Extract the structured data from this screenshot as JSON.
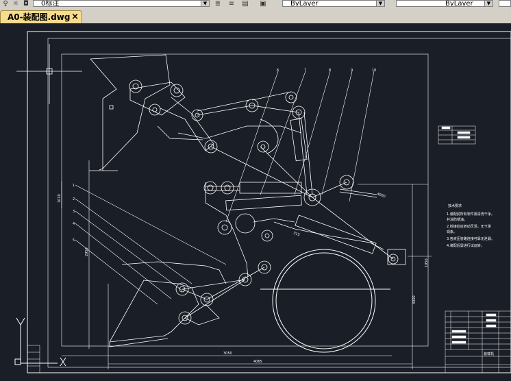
{
  "toolbar": {
    "dimstyle_value": "0标注",
    "layer_value": "ByLayer",
    "linetype_value": "ByLayer",
    "icons": [
      "bulb-icon",
      "sun-icon",
      "style-icon",
      "text-style-icon",
      "table-icon",
      "layer-icon"
    ]
  },
  "document_tab": {
    "label": "A0-装配图.dwg",
    "close_glyph": "×"
  },
  "drawing": {
    "background": "#1a1e27",
    "line_color": "#ffffff",
    "dim_labels": [
      "3050",
      "4065",
      "4000",
      "2950",
      "1010",
      "4900",
      "1050",
      "315"
    ],
    "part_numbers": [
      "6",
      "7",
      "8",
      "9",
      "10",
      "1",
      "2",
      "3",
      "4",
      "5"
    ],
    "tech_requirements": {
      "heading": "技术要求",
      "lines": [
        "1.装配前所有零件需清洗干净，",
        "  并涂防锈油。",
        "2.铰接处应转动灵活，无卡滞",
        "  现象。",
        "3.各液压管路连接可靠无泄漏。",
        "4.装配后需进行试运转。"
      ]
    },
    "title_block_label": "装载机"
  }
}
